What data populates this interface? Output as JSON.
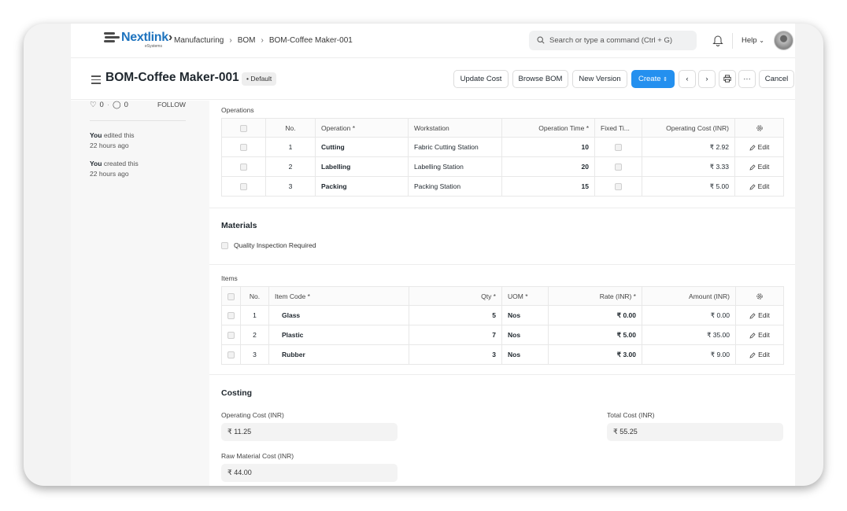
{
  "navbar": {
    "logo_text_blue": "Nextlink",
    "logo_text_dark": "›",
    "logo_sub": "eSystems",
    "breadcrumbs": [
      "Manufacturing",
      "BOM",
      "BOM-Coffee Maker-001"
    ],
    "search_placeholder": "Search or type a command (Ctrl + G)",
    "help_label": "Help"
  },
  "header": {
    "title": "BOM-Coffee Maker-001",
    "status_badge": "Default",
    "buttons": {
      "update_cost": "Update Cost",
      "browse_bom": "Browse BOM",
      "new_version": "New Version",
      "create": "Create",
      "cancel": "Cancel"
    }
  },
  "sidebar": {
    "likes": "0",
    "comments": "0",
    "follow": "FOLLOW",
    "activity": [
      {
        "who": "You",
        "what": "edited this",
        "when": "22 hours ago"
      },
      {
        "who": "You",
        "what": "created this",
        "when": "22 hours ago"
      }
    ]
  },
  "operations": {
    "label": "Operations",
    "columns": [
      "No.",
      "Operation *",
      "Workstation",
      "Operation Time *",
      "Fixed Ti...",
      "Operating Cost (INR)"
    ],
    "rows": [
      {
        "no": "1",
        "operation": "Cutting",
        "workstation": "Fabric Cutting Station",
        "time": "10",
        "cost": "₹ 2.92",
        "edit": "Edit"
      },
      {
        "no": "2",
        "operation": "Labelling",
        "workstation": "Labelling Station",
        "time": "20",
        "cost": "₹ 3.33",
        "edit": "Edit"
      },
      {
        "no": "3",
        "operation": "Packing",
        "workstation": "Packing Station",
        "time": "15",
        "cost": "₹ 5.00",
        "edit": "Edit"
      }
    ]
  },
  "materials": {
    "heading": "Materials",
    "quality_inspection_label": "Quality Inspection Required",
    "quality_inspection_checked": false
  },
  "items": {
    "label": "Items",
    "columns": [
      "No.",
      "Item Code *",
      "Qty *",
      "UOM *",
      "Rate (INR) *",
      "Amount (INR)"
    ],
    "rows": [
      {
        "no": "1",
        "code": "Glass",
        "qty": "5",
        "uom": "Nos",
        "rate": "₹ 0.00",
        "amount": "₹ 0.00",
        "edit": "Edit"
      },
      {
        "no": "2",
        "code": "Plastic",
        "qty": "7",
        "uom": "Nos",
        "rate": "₹ 5.00",
        "amount": "₹ 35.00",
        "edit": "Edit"
      },
      {
        "no": "3",
        "code": "Rubber",
        "qty": "3",
        "uom": "Nos",
        "rate": "₹ 3.00",
        "amount": "₹ 9.00",
        "edit": "Edit"
      }
    ]
  },
  "costing": {
    "heading": "Costing",
    "operating_cost_label": "Operating Cost (INR)",
    "operating_cost_value": "₹ 11.25",
    "total_cost_label": "Total Cost (INR)",
    "total_cost_value": "₹ 55.25",
    "raw_material_cost_label": "Raw Material Cost (INR)",
    "raw_material_cost_value": "₹ 44.00"
  },
  "colors": {
    "primary": "#2490ef",
    "logo_blue": "#1e73be"
  }
}
